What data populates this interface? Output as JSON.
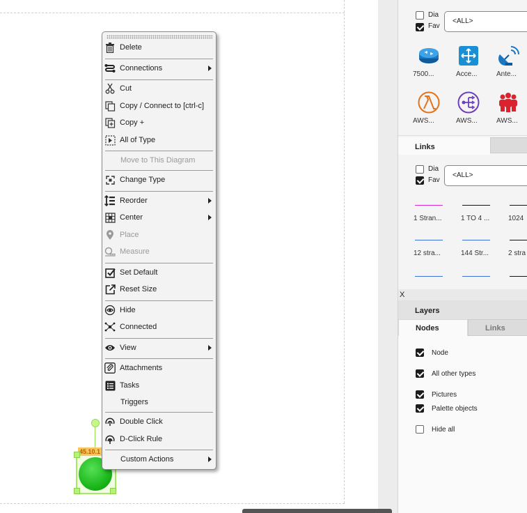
{
  "context_menu": {
    "items": [
      {
        "label": "Delete",
        "icon": "trash-icon"
      },
      {
        "label": "Connections",
        "icon": "connections-icon",
        "submenu": true
      },
      {
        "label": "Cut",
        "icon": "scissors-icon"
      },
      {
        "label": "Copy / Connect to [ctrl-c]",
        "icon": "copy-icon"
      },
      {
        "label": "Copy +",
        "icon": "copy-plus-icon"
      },
      {
        "label": "All of Type",
        "icon": "all-of-type-icon"
      },
      {
        "label": "Move to This Diagram",
        "disabled": true
      },
      {
        "label": "Change Type",
        "icon": "change-type-icon"
      },
      {
        "label": "Reorder",
        "icon": "reorder-icon",
        "submenu": true
      },
      {
        "label": "Center",
        "icon": "center-icon",
        "submenu": true
      },
      {
        "label": "Place",
        "icon": "map-pin-icon",
        "disabled": true
      },
      {
        "label": "Measure",
        "icon": "measure-icon",
        "disabled": true
      },
      {
        "label": "Set Default",
        "icon": "checkbox-checked-icon"
      },
      {
        "label": "Reset Size",
        "icon": "external-link-icon"
      },
      {
        "label": "Hide",
        "icon": "hide-icon"
      },
      {
        "label": "Connected",
        "icon": "connected-nodes-icon"
      },
      {
        "label": "View",
        "icon": "eye-icon",
        "submenu": true
      },
      {
        "label": "Attachments",
        "icon": "paperclip-icon"
      },
      {
        "label": "Tasks",
        "icon": "task-list-icon"
      },
      {
        "label": "Triggers"
      },
      {
        "label": "Double Click",
        "icon": "double-click-icon"
      },
      {
        "label": "D-Click Rule",
        "icon": "click-rule-icon"
      },
      {
        "label": "Custom Actions",
        "submenu": true
      }
    ]
  },
  "node": {
    "label": "45.10.1"
  },
  "palette": {
    "filter_dia_label": "Dia",
    "filter_fav_label": "Fav",
    "filter_dia_checked": false,
    "filter_fav_checked": true,
    "select_value": "<ALL>",
    "items": [
      {
        "caption": "7500...",
        "icon": "router-icon"
      },
      {
        "caption": "Acce...",
        "icon": "access-point-icon"
      },
      {
        "caption": "Ante...",
        "icon": "antenna-dish-icon"
      },
      {
        "caption": "AWS...",
        "icon": "aws-lambda-icon"
      },
      {
        "caption": "AWS...",
        "icon": "aws-step-functions-icon"
      },
      {
        "caption": "AWS...",
        "icon": "aws-users-icon"
      }
    ]
  },
  "links": {
    "header": "Links",
    "filter_dia_label": "Dia",
    "filter_fav_label": "Fav",
    "filter_dia_checked": false,
    "filter_fav_checked": true,
    "select_value": "<ALL>",
    "items": [
      {
        "caption": "1 Stran...",
        "color": "#d62ad6"
      },
      {
        "caption": "1 TO 4 ...",
        "color": "#111111"
      },
      {
        "caption": "1024",
        "color": "#111111"
      },
      {
        "caption": "12 stra...",
        "color": "#3f6fd8"
      },
      {
        "caption": "144 Str...",
        "color": "#3f6fd8"
      },
      {
        "caption": "2 stra",
        "color": "#111111"
      },
      {
        "caption": "",
        "color": "#3f6fd8"
      },
      {
        "caption": "",
        "color": "#3f6fd8"
      },
      {
        "caption": "",
        "color": "#111111"
      }
    ]
  },
  "close_label": "X",
  "layers": {
    "title": "Layers",
    "tabs": [
      {
        "label": "Nodes",
        "active": true
      },
      {
        "label": "Links",
        "active": false
      }
    ],
    "items": [
      {
        "label": "Node",
        "checked": true
      },
      {
        "label": "All other types",
        "checked": true
      },
      {
        "label": "Pictures",
        "checked": true
      },
      {
        "label": "Palette objects",
        "checked": true
      },
      {
        "label": "Hide all",
        "checked": false
      }
    ]
  }
}
